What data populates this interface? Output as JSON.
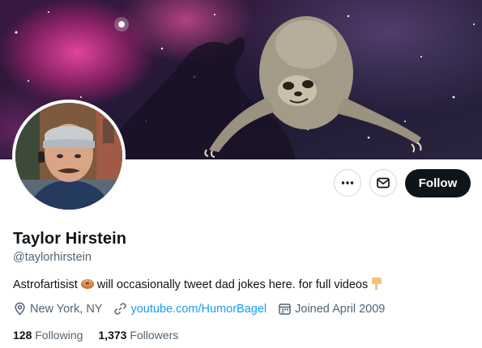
{
  "profile": {
    "name": "Taylor Hirstein",
    "handle": "@taylorhirstein",
    "bio_text": "Astrofartisist",
    "bio_emoji_1": "bagel-emoji",
    "bio_text_2": "will occasionally tweet dad jokes here. for full videos",
    "bio_emoji_2": "pointing-down-emoji",
    "location": "New York, NY",
    "website": "youtube.com/HumorBagel",
    "joined": "Joined April 2009"
  },
  "actions": {
    "more_icon": "more-icon",
    "message_icon": "mail-icon",
    "follow_label": "Follow"
  },
  "stats": {
    "following_count": "128",
    "following_label": "Following",
    "followers_count": "1,373",
    "followers_label": "Followers"
  },
  "colors": {
    "primary_text": "#0f1419",
    "secondary_text": "#536471",
    "link": "#1d9bf0",
    "follow_button_bg": "#0f1419"
  }
}
